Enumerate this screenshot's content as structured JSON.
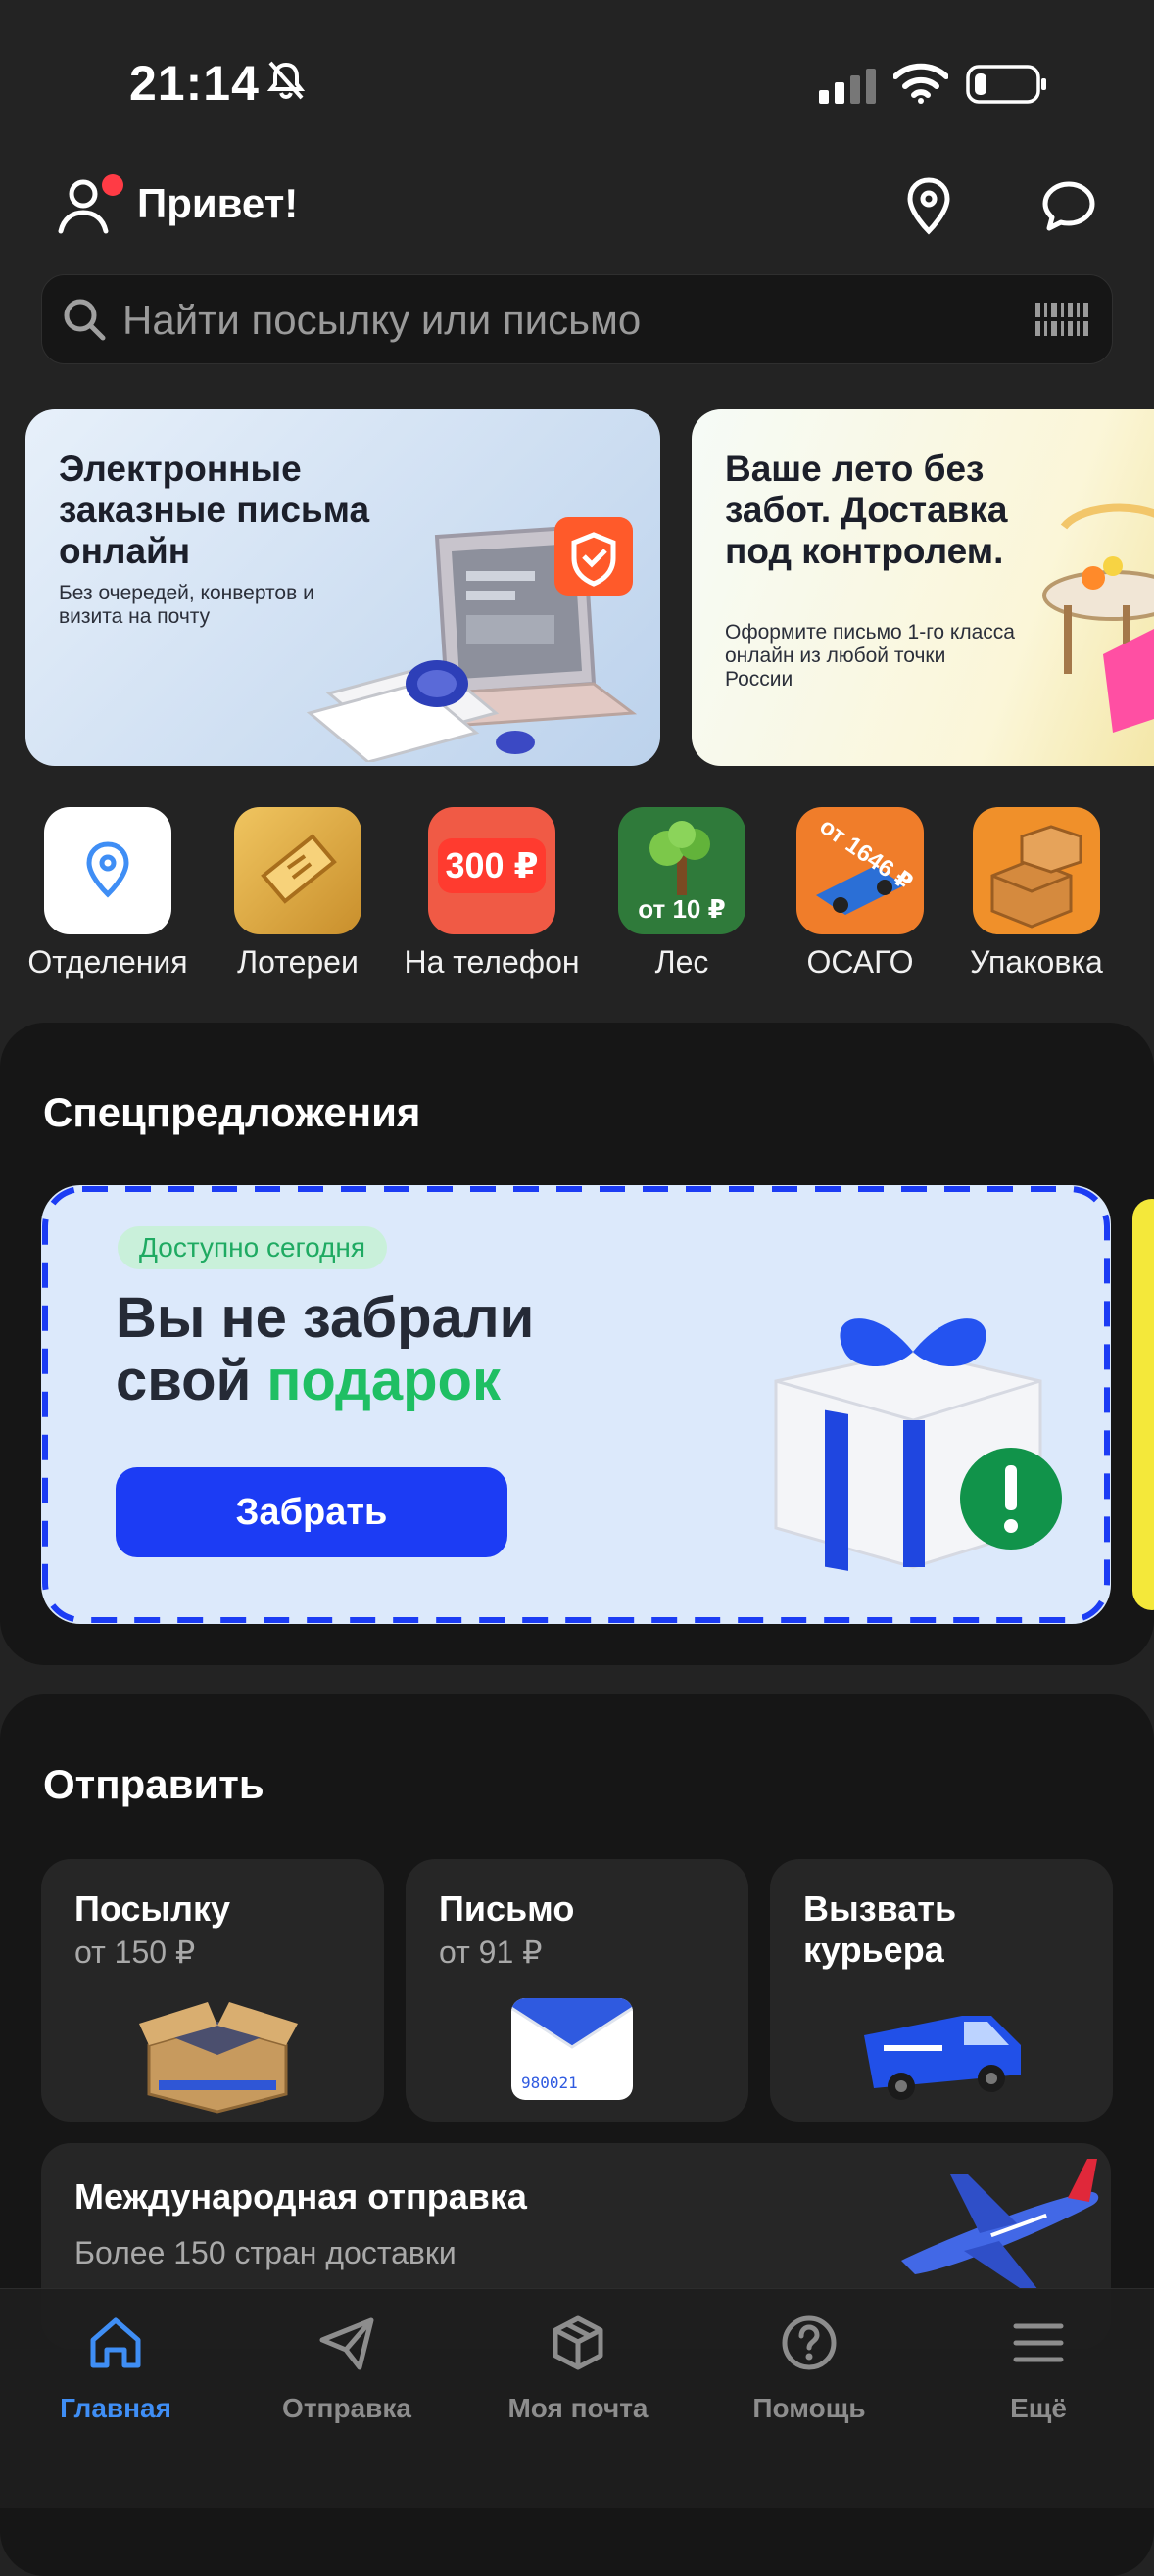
{
  "status_bar": {
    "time": "21:14"
  },
  "header": {
    "greeting": "Привет!"
  },
  "search": {
    "placeholder": "Найти посылку или письмо"
  },
  "banners": [
    {
      "title": "Электронные заказные письма онлайн",
      "text": "Без очередей, конвертов и визита на почту"
    },
    {
      "title": "Ваше лето без забот. Доставка под контролем.",
      "text": "Оформите письмо 1-го класса онлайн из любой точки России"
    }
  ],
  "quick_actions": [
    {
      "label": "Отделения",
      "icon": "location-pin-icon"
    },
    {
      "label": "Лотереи",
      "icon": "lottery-ticket-icon",
      "badge": ""
    },
    {
      "label": "На телефон",
      "icon": "phone-topup-icon",
      "badge": "300 ₽"
    },
    {
      "label": "Лес",
      "icon": "tree-icon",
      "badge": "от 10 ₽"
    },
    {
      "label": "ОСАГО",
      "icon": "car-insurance-icon",
      "badge": "от 1646 ₽"
    },
    {
      "label": "Упаковка",
      "icon": "boxes-icon"
    }
  ],
  "special_offers": {
    "title": "Спецпредложения",
    "promo": {
      "badge": "Доступно сегодня",
      "title_line1": "Вы не забрали",
      "title_line2_prefix": "свой ",
      "title_line2_highlight": "подарок",
      "button": "Забрать"
    }
  },
  "send": {
    "title": "Отправить",
    "cards": [
      {
        "title": "Посылку",
        "subtitle": "от 150 ₽"
      },
      {
        "title": "Письмо",
        "subtitle": "от 91 ₽",
        "envelope_code": "980021"
      },
      {
        "title_line1": "Вызвать",
        "title_line2": "курьера"
      }
    ],
    "international": {
      "title": "Международная отправка",
      "subtitle": "Более 150 стран доставки"
    }
  },
  "bottom_nav": [
    {
      "label": "Главная",
      "icon": "home-icon",
      "active": true
    },
    {
      "label": "Отправка",
      "icon": "send-plane-icon"
    },
    {
      "label": "Моя почта",
      "icon": "box-icon"
    },
    {
      "label": "Помощь",
      "icon": "help-icon"
    },
    {
      "label": "Ещё",
      "icon": "menu-icon"
    }
  ],
  "colors": {
    "accent_blue": "#1c3cf4",
    "highlight_green": "#1fbf63",
    "nav_active": "#3f8ef5",
    "background": "#232323"
  }
}
